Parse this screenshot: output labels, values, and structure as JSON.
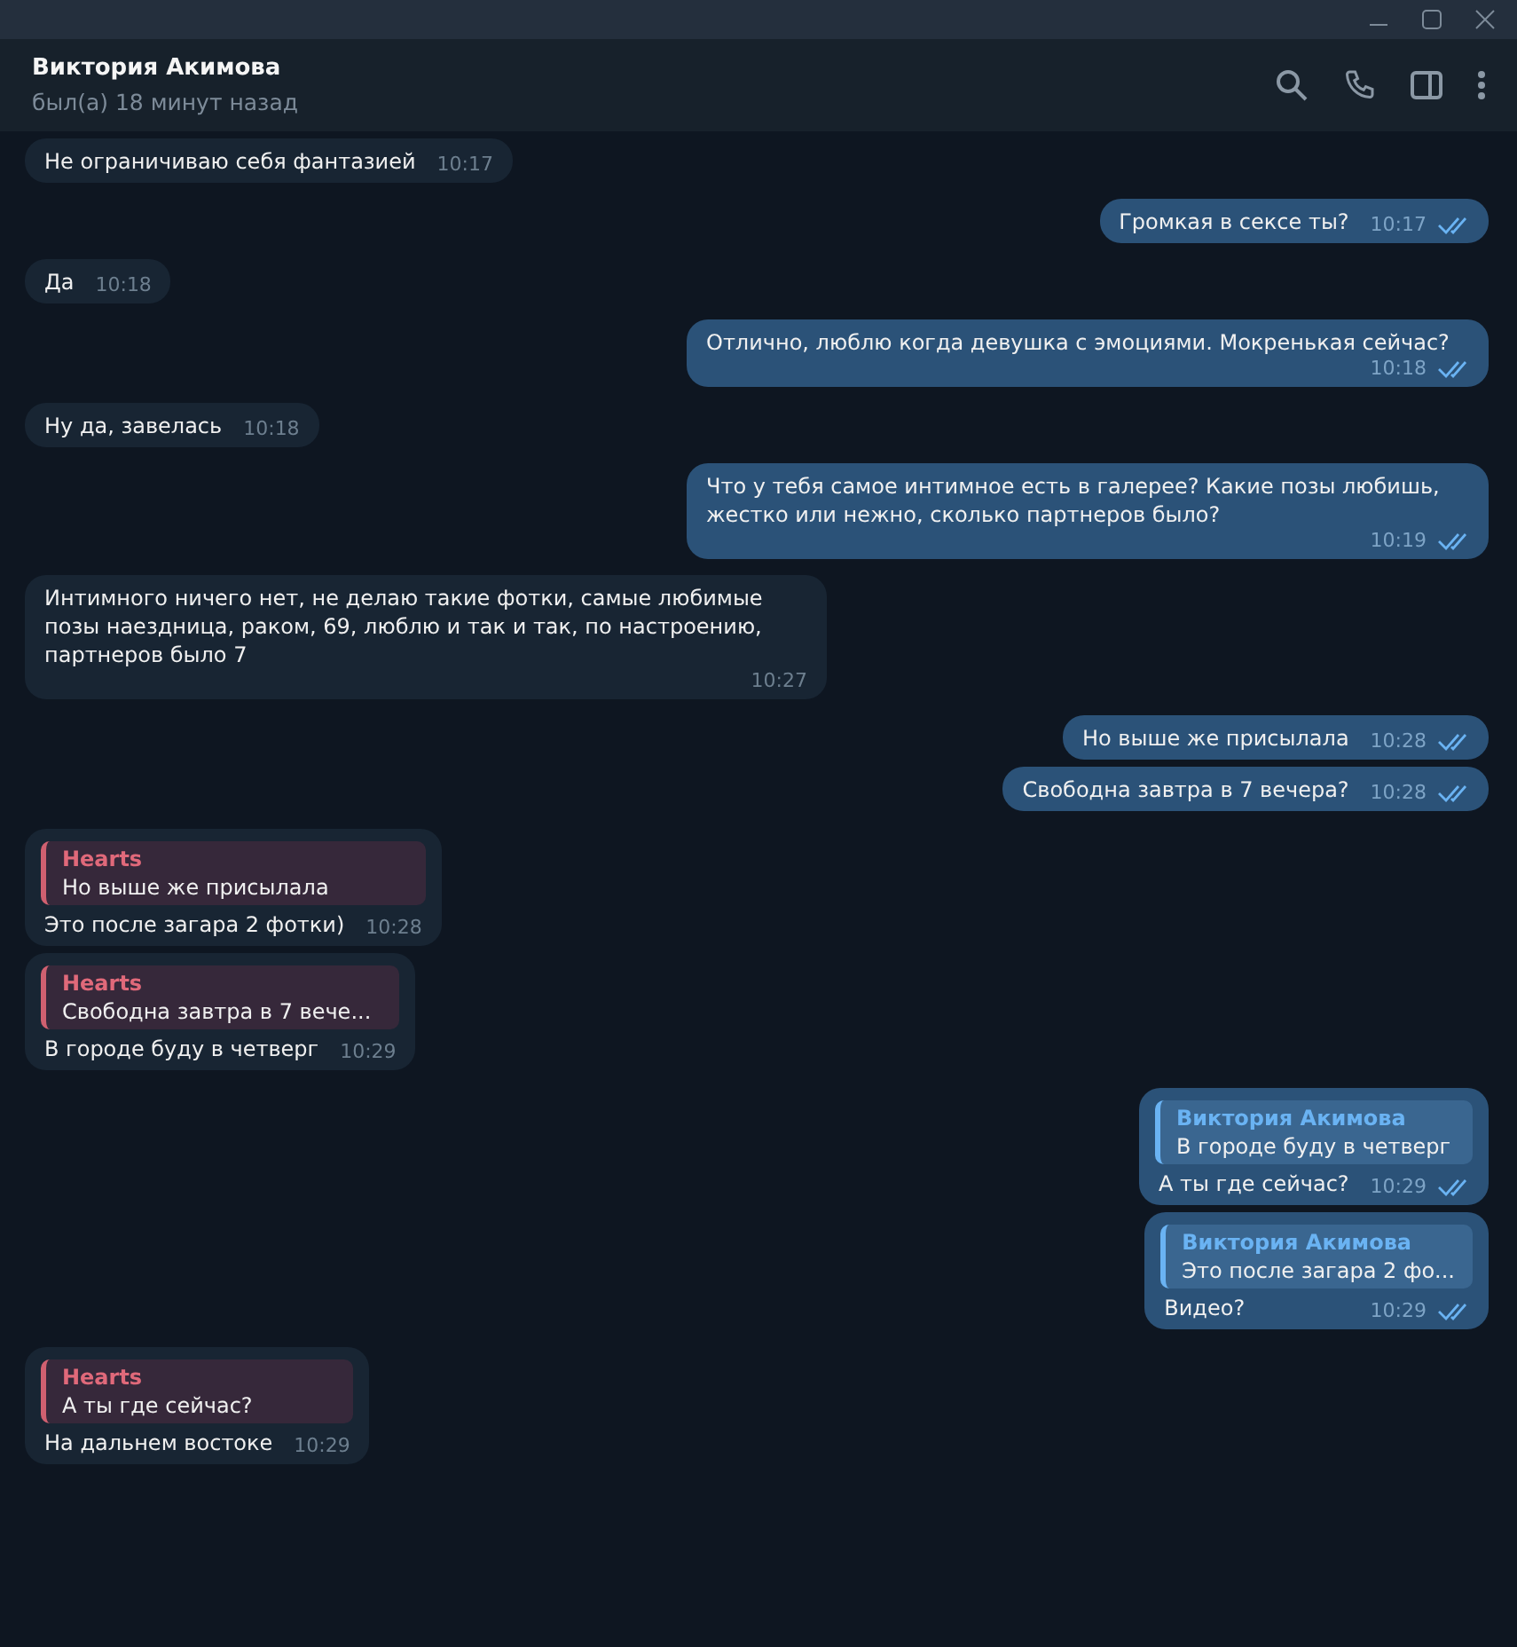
{
  "header": {
    "name": "Виктория Акимова",
    "status": "был(а) 18 минут назад"
  },
  "messages": [
    {
      "kind": "in",
      "text": "Не ограничиваю себя фантазией",
      "time": "10:17"
    },
    {
      "kind": "out",
      "text": "Громкая в сексе ты?",
      "time": "10:17",
      "read": true
    },
    {
      "kind": "in",
      "text": "Да",
      "time": "10:18"
    },
    {
      "kind": "out",
      "text": "Отлично, люблю когда девушка с эмоциями. Мокренькая сейчас?",
      "time": "10:18",
      "read": true
    },
    {
      "kind": "in",
      "text": "Ну да, завелась",
      "time": "10:18"
    },
    {
      "kind": "out",
      "text": "Что у тебя самое интимное есть в галерее? Какие позы любишь, жестко или нежно, сколько партнеров было?",
      "time": "10:19",
      "read": true
    },
    {
      "kind": "in",
      "text": "Интимного ничего нет, не делаю такие фотки, самые любимые позы наездница, раком, 69, люблю и так и так, по настроению, партнеров было 7",
      "time": "10:27"
    },
    {
      "kind": "out",
      "text": "Но выше же присылала",
      "time": "10:28",
      "read": true
    },
    {
      "kind": "out",
      "text": "Свободна завтра в 7 вечера?",
      "time": "10:28",
      "read": true
    },
    {
      "kind": "in",
      "text": "Это после загара 2 фотки)",
      "time": "10:28",
      "reply": {
        "author": "Hearts",
        "text": "Но выше же присылала"
      }
    },
    {
      "kind": "in",
      "text": "В городе буду в четверг",
      "time": "10:29",
      "reply": {
        "author": "Hearts",
        "text": "Свободна завтра в 7 вече..."
      }
    },
    {
      "kind": "out",
      "text": "А ты где сейчас?",
      "time": "10:29",
      "read": true,
      "reply": {
        "author": "Виктория Акимова",
        "text": "В городе буду в четверг"
      }
    },
    {
      "kind": "out",
      "text": "Видео?",
      "time": "10:29",
      "read": true,
      "reply": {
        "author": "Виктория Акимова",
        "text": "Это после загара 2 фо..."
      }
    },
    {
      "kind": "in",
      "text": "На дальнем востоке",
      "time": "10:29",
      "reply": {
        "author": "Hearts",
        "text": "А ты где сейчас?"
      }
    }
  ]
}
